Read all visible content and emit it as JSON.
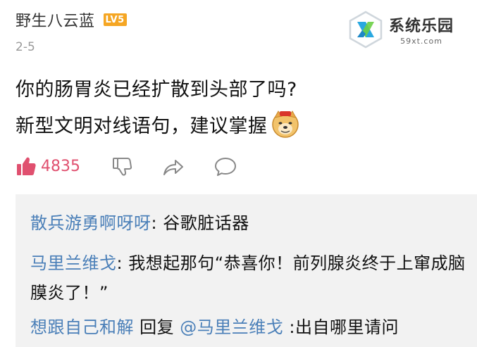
{
  "post": {
    "username": "野生八云蓝",
    "level": "LV5",
    "date": "2-5",
    "line1": "你的肠胃炎已经扩散到头部了吗?",
    "line2": "新型文明对线语句，建议掌握",
    "emoji": "doge-icon"
  },
  "actions": {
    "like_count": "4835",
    "icons": [
      "thumbs-up-icon",
      "thumbs-down-icon",
      "share-icon",
      "comment-icon"
    ]
  },
  "watermark": {
    "name": "系统乐园",
    "url": "59xt.com"
  },
  "comments": [
    {
      "user": "散兵游勇啊呀呀",
      "sep": ": ",
      "text": "谷歌脏话器"
    },
    {
      "user": "马里兰维戈",
      "sep": ": ",
      "text": "我想起那句“恭喜你！前列腺炎终于上窜成脑膜炎了！”"
    },
    {
      "user": "想跟自己和解",
      "reply_word": " 回复 ",
      "mention": "@马里兰维戈",
      "text": " :出自哪里请问"
    }
  ],
  "colors": {
    "accent_link": "#4a7fb8",
    "like": "#e0506f",
    "badge": "#f5a623"
  }
}
